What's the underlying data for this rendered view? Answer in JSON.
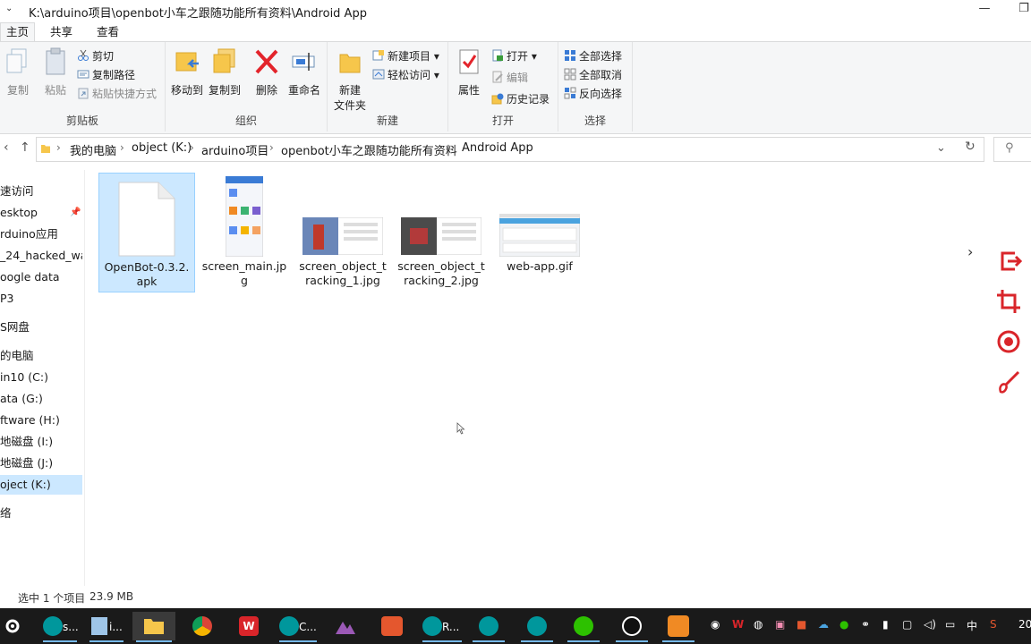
{
  "window": {
    "title": "K:\\arduino项目\\openbot小车之跟随功能所有资料\\Android  App",
    "qa_glyph": "⌄",
    "min_glyph": "—",
    "max_glyph": "❐"
  },
  "tabs": [
    "主页",
    "共享",
    "查看"
  ],
  "ribbon": {
    "clipboard": {
      "label": "剪贴板",
      "copy": "复制",
      "paste": "粘贴",
      "cut": "剪切",
      "copy_path": "复制路径",
      "paste_shortcut": "粘贴快捷方式"
    },
    "organize": {
      "label": "组织",
      "move_to": "移动到",
      "copy_to": "复制到",
      "delete": "删除",
      "rename": "重命名"
    },
    "new": {
      "label": "新建",
      "new_folder_line1": "新建",
      "new_folder_line2": "文件夹",
      "new_item": "新建项目",
      "easy_access": "轻松访问"
    },
    "open": {
      "label": "打开",
      "properties": "属性",
      "open": "打开",
      "edit": "编辑",
      "history": "历史记录"
    },
    "select": {
      "label": "选择",
      "select_all": "全部选择",
      "select_none": "全部取消",
      "invert": "反向选择"
    }
  },
  "address": {
    "crumbs": [
      "我的电脑",
      "object (K:)",
      "arduino项目",
      "openbot小车之跟随功能所有资料",
      "Android  App"
    ],
    "back_glyph": "‹",
    "up_glyph": "↑",
    "refresh_glyph": "↻",
    "dropdown_glyph": "⌄",
    "search_glyph": "⚲"
  },
  "nav": [
    {
      "label": "速访问"
    },
    {
      "label": "esktop"
    },
    {
      "label": "rduino应用"
    },
    {
      "label": "_24_hacked_wal"
    },
    {
      "label": "oogle  data"
    },
    {
      "label": "P3"
    },
    {
      "label": "S网盘"
    },
    {
      "label": "的电脑"
    },
    {
      "label": "in10 (C:)"
    },
    {
      "label": "ata (G:)"
    },
    {
      "label": "ftware (H:)"
    },
    {
      "label": "地磁盘 (I:)"
    },
    {
      "label": "地磁盘 (J:)"
    },
    {
      "label": "oject (K:)"
    },
    {
      "label": "络"
    }
  ],
  "files": [
    {
      "name": "OpenBot-0.3.2.apk",
      "selected": true
    },
    {
      "name": "screen_main.jpg",
      "selected": false
    },
    {
      "name": "screen_object_tracking_1.jpg",
      "selected": false
    },
    {
      "name": "screen_object_tracking_2.jpg",
      "selected": false
    },
    {
      "name": "web-app.gif",
      "selected": false
    }
  ],
  "status": {
    "selected": "选中 1 个项目",
    "size": "23.9 MB"
  },
  "taskbar": {
    "items": [
      {
        "icon": "gear-icon",
        "label": ""
      },
      {
        "icon": "arduino-icon",
        "label": "s..."
      },
      {
        "icon": "notepad-icon",
        "label": "i..."
      },
      {
        "icon": "folder-icon",
        "label": ""
      },
      {
        "icon": "chrome-icon",
        "label": ""
      },
      {
        "icon": "wps-icon",
        "label": ""
      },
      {
        "icon": "arduino-icon",
        "label": "C..."
      },
      {
        "icon": "mountain-icon",
        "label": ""
      },
      {
        "icon": "video-icon",
        "label": ""
      },
      {
        "icon": "arduino-icon",
        "label": "R..."
      },
      {
        "icon": "arduino-icon",
        "label": ""
      },
      {
        "icon": "arduino-icon",
        "label": ""
      },
      {
        "icon": "wechat-icon",
        "label": ""
      },
      {
        "icon": "obs-icon",
        "label": ""
      },
      {
        "icon": "scissors-icon",
        "label": ""
      }
    ],
    "tray_ime": "中",
    "clock_fragment": "20"
  },
  "colors": {
    "selection": "#cce8ff",
    "selection_border": "#99d1ff",
    "taskbar": "#1a1a1a",
    "ribbon": "#f5f6f7",
    "delete_red": "#e3242b",
    "tool_red": "#d9252a"
  }
}
